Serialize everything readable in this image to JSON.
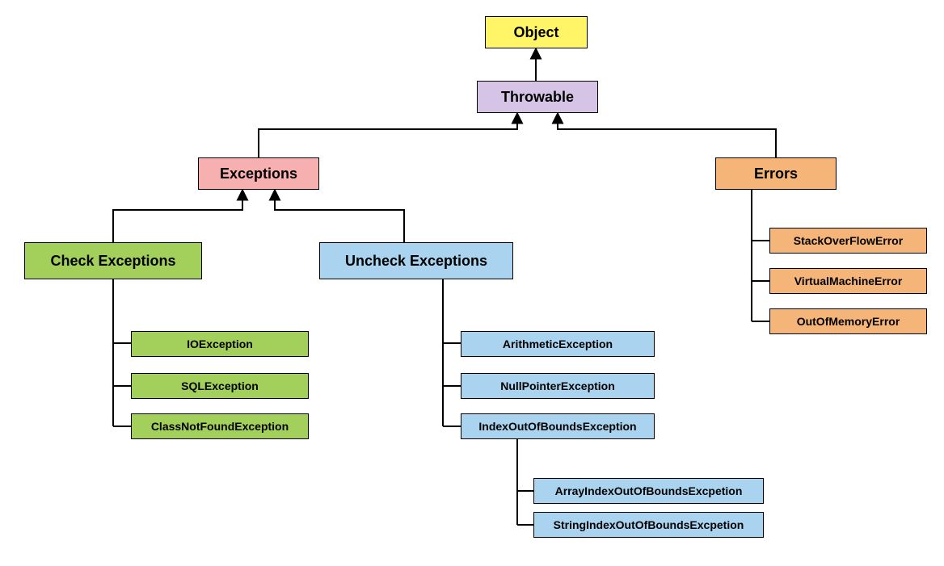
{
  "chart_data": {
    "type": "hierarchy-diagram",
    "root": "Object",
    "edges": [
      [
        "Throwable",
        "Object"
      ],
      [
        "Exceptions",
        "Throwable"
      ],
      [
        "Errors",
        "Throwable"
      ],
      [
        "Check Exceptions",
        "Exceptions"
      ],
      [
        "Uncheck Exceptions",
        "Exceptions"
      ],
      [
        "IOException",
        "Check Exceptions"
      ],
      [
        "SQLException",
        "Check Exceptions"
      ],
      [
        "ClassNotFoundException",
        "Check Exceptions"
      ],
      [
        "ArithmeticException",
        "Uncheck Exceptions"
      ],
      [
        "NullPointerException",
        "Uncheck Exceptions"
      ],
      [
        "IndexOutOfBoundsException",
        "Uncheck Exceptions"
      ],
      [
        "ArrayIndexOutOfBoundsExcpetion",
        "IndexOutOfBoundsException"
      ],
      [
        "StringIndexOutOfBoundsExcpetion",
        "IndexOutOfBoundsException"
      ],
      [
        "StackOverFlowError",
        "Errors"
      ],
      [
        "VirtualMachineError",
        "Errors"
      ],
      [
        "OutOfMemoryError",
        "Errors"
      ]
    ]
  },
  "nodes": {
    "object": "Object",
    "throwable": "Throwable",
    "exceptions": "Exceptions",
    "errors": "Errors",
    "check": "Check Exceptions",
    "uncheck": "Uncheck Exceptions",
    "ioexception": "IOException",
    "sqlexception": "SQLException",
    "classnotfound": "ClassNotFoundException",
    "arithmetic": "ArithmeticException",
    "nullpointer": "NullPointerException",
    "indexoob": "IndexOutOfBoundsException",
    "arrayoob": "ArrayIndexOutOfBoundsExcpetion",
    "stringoob": "StringIndexOutOfBoundsExcpetion",
    "stackoverflow": "StackOverFlowError",
    "virtualmachine": "VirtualMachineError",
    "outofmemory": "OutOfMemoryError"
  },
  "colors": {
    "object": "#fff566",
    "throwable": "#d6c4e6",
    "exceptions": "#f6b0b0",
    "errors": "#f5b578",
    "check": "#a2d05a",
    "uncheck": "#aad3f0"
  }
}
